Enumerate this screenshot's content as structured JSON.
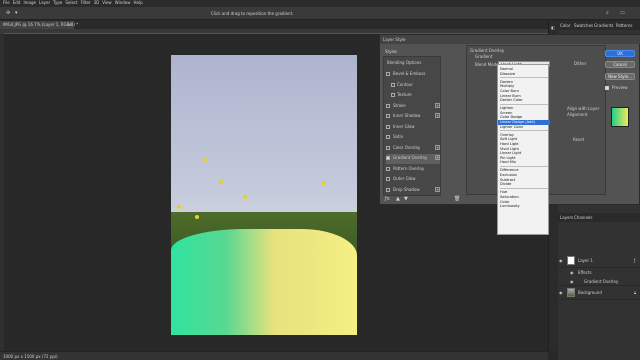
{
  "menubar": {
    "items": [
      "File",
      "Edit",
      "Image",
      "Layer",
      "Type",
      "Select",
      "Filter",
      "3D",
      "View",
      "Window",
      "Help"
    ]
  },
  "optionsbar": {
    "hint": "Click and drag to reposition the gradient."
  },
  "document": {
    "tab_title": "IMG4.JPG @ 16.7% (Layer 1, RGB/8) *",
    "status": "1000 px x 1500 px (72 ppi)"
  },
  "right_panel": {
    "tabs": [
      "Color",
      "Swatches",
      "Gradients",
      "Patterns"
    ],
    "layers_tabs": [
      "Layers",
      "Channels"
    ],
    "layers": [
      {
        "name": "Layer 1"
      },
      {
        "name": "Effects"
      },
      {
        "name": "Gradient Overlay"
      },
      {
        "name": "Background"
      }
    ]
  },
  "dialog": {
    "title": "Layer Style",
    "styles_header": "Styles",
    "blending_options": "Blending Options",
    "styles": [
      {
        "label": "Bevel & Emboss",
        "checked": false,
        "plus": false
      },
      {
        "label": "Contour",
        "checked": false,
        "plus": false
      },
      {
        "label": "Texture",
        "checked": false,
        "plus": false
      },
      {
        "label": "Stroke",
        "checked": false,
        "plus": true
      },
      {
        "label": "Inner Shadow",
        "checked": false,
        "plus": true
      },
      {
        "label": "Inner Glow",
        "checked": false,
        "plus": false
      },
      {
        "label": "Satin",
        "checked": false,
        "plus": false
      },
      {
        "label": "Color Overlay",
        "checked": false,
        "plus": true
      },
      {
        "label": "Gradient Overlay",
        "checked": true,
        "plus": true
      },
      {
        "label": "Pattern Overlay",
        "checked": false,
        "plus": false
      },
      {
        "label": "Outer Glow",
        "checked": false,
        "plus": false
      },
      {
        "label": "Drop Shadow",
        "checked": false,
        "plus": true
      }
    ],
    "section_title": "Gradient Overlay",
    "section_sub": "Gradient",
    "blend_mode_label": "Blend Mode:",
    "blend_mode_value": "Hard Light",
    "dither_label": "Dither",
    "buttons": {
      "ok": "OK",
      "cancel": "Cancel",
      "new_style": "New Style...",
      "preview": "Preview"
    },
    "side_labels": {
      "align": "Align with Layer",
      "alignment": "Alignment",
      "reset": "Reset"
    }
  },
  "blend_dropdown": {
    "selected": "Linear Dodge (Add)",
    "groups": [
      [
        "Normal",
        "Dissolve"
      ],
      [
        "Darken",
        "Multiply",
        "Color Burn",
        "Linear Burn",
        "Darker Color"
      ],
      [
        "Lighten",
        "Screen",
        "Color Dodge",
        "Linear Dodge (Add)",
        "Lighter Color"
      ],
      [
        "Overlay",
        "Soft Light",
        "Hard Light",
        "Vivid Light",
        "Linear Light",
        "Pin Light",
        "Hard Mix"
      ],
      [
        "Difference",
        "Exclusion",
        "Subtract",
        "Divide"
      ],
      [
        "Hue",
        "Saturation",
        "Color",
        "Luminosity"
      ]
    ]
  },
  "colors": {
    "accent": "#2f6fd6",
    "gradient_start": "#2fe3a0",
    "gradient_end": "#f4f084"
  }
}
